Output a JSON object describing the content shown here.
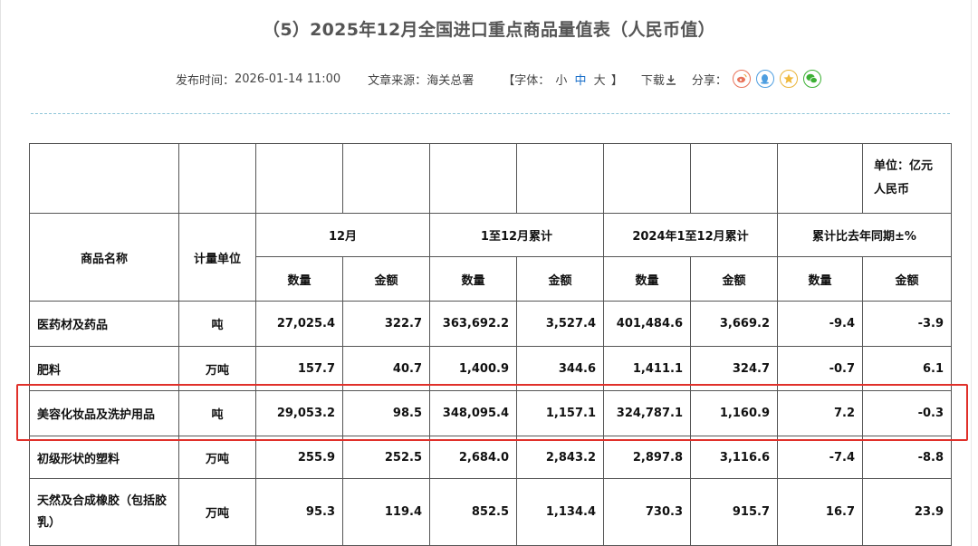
{
  "page": {
    "title": "（5）2025年12月全国进口重点商品量值表（人民币值）"
  },
  "meta": {
    "publish_label": "发布时间：",
    "publish_time": "2026-01-14 11:00",
    "source_label": "文章来源：",
    "source": "海关总署",
    "font_open": "【字体：",
    "font_small": "小",
    "font_medium": "中",
    "font_large": "大",
    "font_close": "】",
    "download_label": "下载",
    "share_label": "分享：",
    "share_icons": [
      "weibo-icon",
      "qq-icon",
      "qzone-icon",
      "wechat-icon"
    ]
  },
  "table": {
    "unit_note": "单位：亿元人民币",
    "col_name": "商品名称",
    "col_unit": "计量单位",
    "groups": [
      "12月",
      "1至12月累计",
      "2024年1至12月累计",
      "累计比去年同期±%"
    ],
    "sub": {
      "qty": "数量",
      "amt": "金额"
    },
    "rows": [
      {
        "name": "医药材及药品",
        "unit": "吨",
        "m_qty": "27,025.4",
        "m_amt": "322.7",
        "c_qty": "363,692.2",
        "c_amt": "3,527.4",
        "p_qty": "401,484.6",
        "p_amt": "3,669.2",
        "y_qty": "-9.4",
        "y_amt": "-3.9"
      },
      {
        "name": "肥料",
        "unit": "万吨",
        "m_qty": "157.7",
        "m_amt": "40.7",
        "c_qty": "1,400.9",
        "c_amt": "344.6",
        "p_qty": "1,411.1",
        "p_amt": "324.7",
        "y_qty": "-0.7",
        "y_amt": "6.1"
      },
      {
        "name": "美容化妆品及洗护用品",
        "unit": "吨",
        "m_qty": "29,053.2",
        "m_amt": "98.5",
        "c_qty": "348,095.4",
        "c_amt": "1,157.1",
        "p_qty": "324,787.1",
        "p_amt": "1,160.9",
        "y_qty": "7.2",
        "y_amt": "-0.3"
      },
      {
        "name": "初级形状的塑料",
        "unit": "万吨",
        "m_qty": "255.9",
        "m_amt": "252.5",
        "c_qty": "2,684.0",
        "c_amt": "2,843.2",
        "p_qty": "2,897.8",
        "p_amt": "3,116.6",
        "y_qty": "-7.4",
        "y_amt": "-8.8"
      },
      {
        "name": "天然及合成橡胶（包括胶乳）",
        "unit": "万吨",
        "m_qty": "95.3",
        "m_amt": "119.4",
        "c_qty": "852.5",
        "c_amt": "1,134.4",
        "p_qty": "730.3",
        "p_amt": "915.7",
        "y_qty": "16.7",
        "y_amt": "23.9"
      }
    ]
  },
  "colors": {
    "highlight": "#e0302a",
    "active_font": "#1a6fc9",
    "dashed_rule": "#8ec5d8"
  }
}
